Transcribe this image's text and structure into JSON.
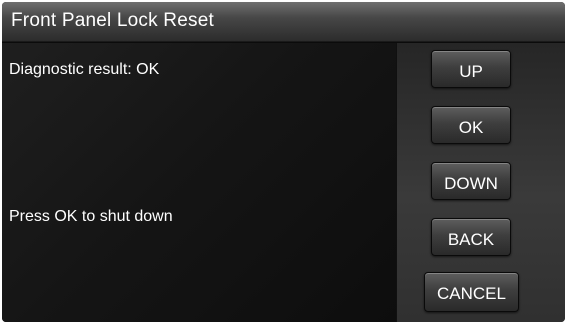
{
  "window": {
    "title": "Front Panel Lock Reset"
  },
  "main": {
    "diagnostic_text": "Diagnostic result: OK",
    "instruction_text": "Press OK to shut down"
  },
  "buttons": {
    "up": "UP",
    "ok": "OK",
    "down": "DOWN",
    "back": "BACK",
    "cancel": "CANCEL"
  },
  "colors": {
    "background": "#0b0b0b",
    "text": "#ffffff",
    "title_bar": "#474747",
    "button": "#3e3e3e"
  }
}
